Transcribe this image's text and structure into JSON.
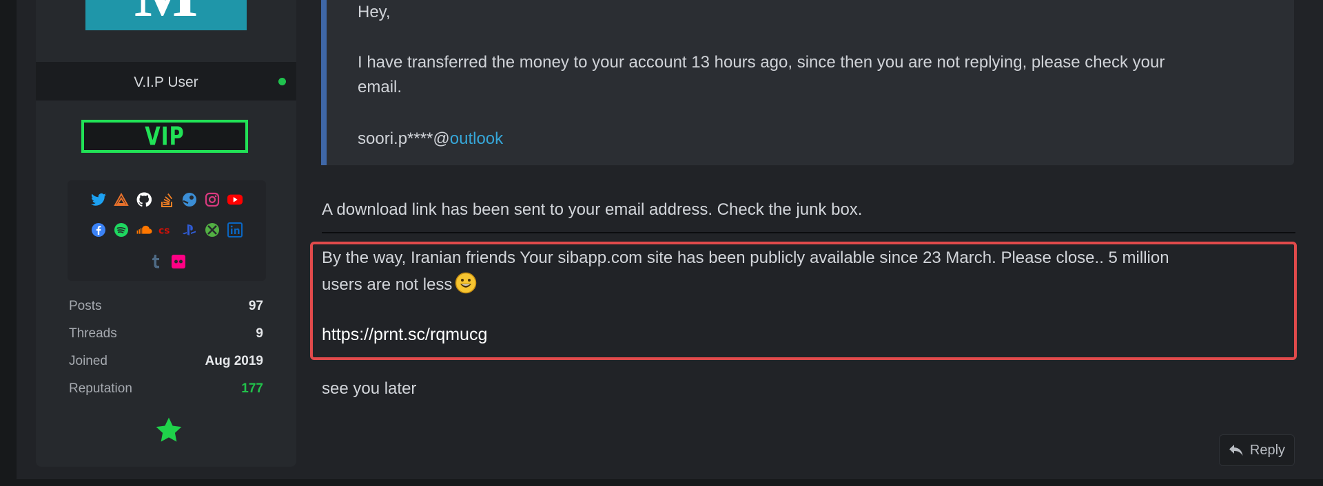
{
  "user": {
    "avatar_letter": "M",
    "role": "V.I.P User",
    "badge": "VIP",
    "social_row1": [
      {
        "icon": "twitter-icon",
        "color": "#1da1f2"
      },
      {
        "icon": "hackthebox-icon",
        "color": "#e8712b"
      },
      {
        "icon": "github-icon",
        "color": "#ffffff"
      },
      {
        "icon": "stackoverflow-icon",
        "color": "#f48024"
      },
      {
        "icon": "steam-icon",
        "color": "#3b8ed6"
      },
      {
        "icon": "instagram-icon",
        "color": "#d93a7f"
      },
      {
        "icon": "youtube-icon",
        "color": "#ff0000"
      }
    ],
    "social_row2": [
      {
        "icon": "facebook-icon",
        "color": "#3b82f6"
      },
      {
        "icon": "spotify-icon",
        "color": "#1ed760"
      },
      {
        "icon": "soundcloud-icon",
        "color": "#ff7700"
      },
      {
        "icon": "lastfm-icon",
        "color": "#d51007"
      },
      {
        "icon": "playstation-icon",
        "color": "#2f5cd7"
      },
      {
        "icon": "xbox-icon",
        "color": "#52b043"
      },
      {
        "icon": "linkedin-icon",
        "color": "#0a66c2"
      }
    ],
    "social_row3": [
      {
        "icon": "tumblr-icon",
        "color": "#4e6a85"
      },
      {
        "icon": "flickr-icon",
        "color": "#ff0084"
      }
    ],
    "stats": {
      "posts_label": "Posts",
      "posts": "97",
      "threads_label": "Threads",
      "threads": "9",
      "joined_label": "Joined",
      "joined": "Aug 2019",
      "reputation_label": "Reputation",
      "reputation": "177"
    }
  },
  "quote": {
    "line1": "Hey,",
    "line2": "I have transferred the money to your account 13 hours ago, since then you are not replying, please check your",
    "line3": "email.",
    "email_prefix": "soori.p****@",
    "email_link": "outlook"
  },
  "message": {
    "reply_text": "A download link has been sent to your email address. Check the junk box.",
    "highlight_line1": "By the way, Iranian friends Your sibapp.com site has been publicly available since 23 March. Please close.. 5 million",
    "highlight_line2": "users are not less",
    "link": "https://prnt.sc/rqmucg",
    "closing": "see you later"
  },
  "actions": {
    "reply_label": "Reply"
  },
  "colors": {
    "accent_green": "#21e156",
    "highlight_red": "#e14a4b",
    "link_blue": "#36a7d9",
    "quote_bar": "#3f67a7"
  }
}
